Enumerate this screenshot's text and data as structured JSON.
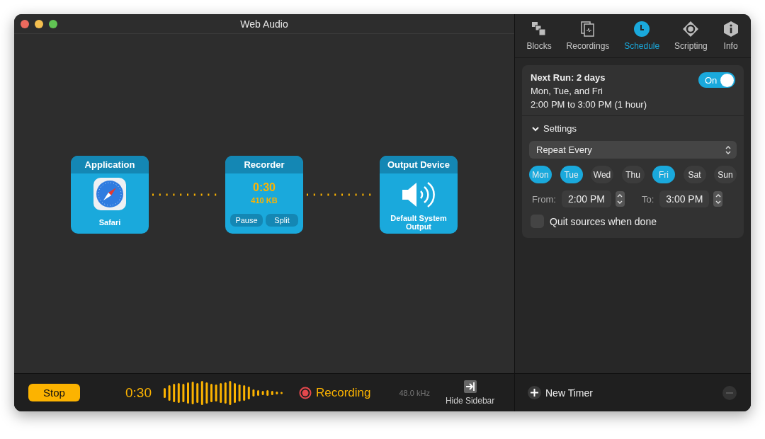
{
  "window": {
    "title": "Web Audio"
  },
  "canvas": {
    "nodes": [
      {
        "kind": "source",
        "title": "Application",
        "label": "Safari"
      },
      {
        "kind": "recorder",
        "title": "Recorder",
        "time": "0:30",
        "size": "410 KB",
        "buttons": [
          "Pause",
          "Split"
        ]
      },
      {
        "kind": "output",
        "title": "Output Device",
        "label": "Default System Output"
      }
    ]
  },
  "bottom_bar": {
    "stop": "Stop",
    "elapsed": "0:30",
    "status": "Recording",
    "sample_rate": "48.0 kHz",
    "hide_sidebar": "Hide Sidebar"
  },
  "sidebar": {
    "tabs": [
      {
        "kind": "blocks",
        "label": "Blocks",
        "selected": false
      },
      {
        "kind": "recordings",
        "label": "Recordings",
        "selected": false
      },
      {
        "kind": "schedule",
        "label": "Schedule",
        "selected": true
      },
      {
        "kind": "scripting",
        "label": "Scripting",
        "selected": false
      },
      {
        "kind": "info",
        "label": "Info",
        "selected": false
      }
    ],
    "schedule": {
      "next_run": "Next Run: 2 days",
      "days_summary": "Mon, Tue, and Fri",
      "time_summary": "2:00 PM to 3:00 PM (1 hour)",
      "toggle": {
        "label": "On",
        "on": true
      },
      "settings": {
        "label": "Settings",
        "expanded": true
      },
      "repeat": "Repeat Every",
      "days": [
        {
          "label": "Mon",
          "selected": true
        },
        {
          "label": "Tue",
          "selected": true
        },
        {
          "label": "Wed",
          "selected": false
        },
        {
          "label": "Thu",
          "selected": false
        },
        {
          "label": "Fri",
          "selected": true
        },
        {
          "label": "Sat",
          "selected": false
        },
        {
          "label": "Sun",
          "selected": false
        }
      ],
      "from_label": "From:",
      "from_value": "2:00 PM",
      "to_label": "To:",
      "to_value": "3:00 PM",
      "quit_checkbox": {
        "label": "Quit sources when done",
        "checked": false
      }
    },
    "footer": {
      "new_timer": "New Timer"
    }
  }
}
